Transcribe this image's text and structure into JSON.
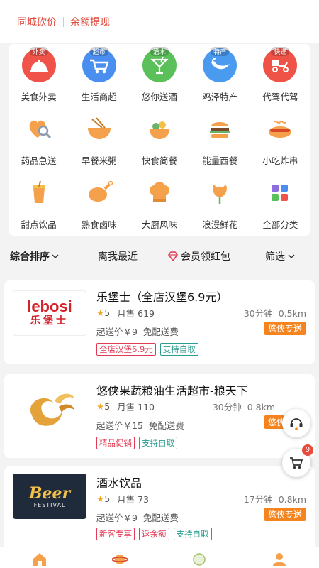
{
  "top": {
    "link1": "同城砍价",
    "link2": "余额提现"
  },
  "categories": [
    {
      "label": "美食外卖",
      "badge": "外卖",
      "icon": "food-cloche-icon",
      "color": "#f0534a"
    },
    {
      "label": "生活商超",
      "badge": "超市",
      "icon": "shopping-cart-icon",
      "color": "#4a8ff0"
    },
    {
      "label": "悠你送酒",
      "badge": "酒水",
      "icon": "cocktail-glass-icon",
      "color": "#5bc05a"
    },
    {
      "label": "鸡泽特产",
      "badge": "特产",
      "icon": "chili-pepper-icon",
      "color": "#4a9aef"
    },
    {
      "label": "代驾代驾",
      "badge": "快递",
      "icon": "delivery-scooter-icon",
      "color": "#ef5246"
    },
    {
      "label": "药品急送",
      "icon": "heart-magnifier-icon"
    },
    {
      "label": "早餐米粥",
      "icon": "noodle-bowl-icon"
    },
    {
      "label": "快食简餐",
      "icon": "rice-bowl-icon"
    },
    {
      "label": "能量西餐",
      "icon": "burger-icon"
    },
    {
      "label": "小吃炸串",
      "icon": "hotdog-icon"
    },
    {
      "label": "甜点饮品",
      "icon": "drink-cup-icon"
    },
    {
      "label": "熟食卤味",
      "icon": "roast-chicken-icon"
    },
    {
      "label": "大厨风味",
      "icon": "chef-hat-icon"
    },
    {
      "label": "浪漫鲜花",
      "icon": "flower-icon"
    },
    {
      "label": "全部分类",
      "icon": "all-categories-icon"
    }
  ],
  "sort": {
    "comprehensive": "综合排序",
    "nearest": "离我最近",
    "member": "会员领红包",
    "filter": "筛选"
  },
  "stores": [
    {
      "name": "乐堡士（全店汉堡6.9元）",
      "rating": "5",
      "sales": "月售 619",
      "time": "30分钟",
      "distance": "0.5km",
      "min_order": "起送价￥9",
      "delivery_fee": "免配送费",
      "delivery": "悠侠专送",
      "tags": [
        {
          "text": "全店汉堡6.9元",
          "kind": "red"
        },
        {
          "text": "支持自取",
          "kind": "green"
        }
      ],
      "logo_text": "lebosi",
      "logo_sub": "乐堡士"
    },
    {
      "name": "悠侠果蔬粮油生活超市-粮天下",
      "rating": "5",
      "sales": "月售 110",
      "time": "30分钟",
      "distance": "0.8km",
      "min_order": "起送价￥15",
      "delivery_fee": "免配送费",
      "delivery": "悠侠专送",
      "tags": [
        {
          "text": "精品促销",
          "kind": "red"
        },
        {
          "text": "支持自取",
          "kind": "green"
        }
      ]
    },
    {
      "name": "酒水饮品",
      "rating": "5",
      "sales": "月售 73",
      "time": "17分钟",
      "distance": "0.8km",
      "min_order": "起送价￥9",
      "delivery_fee": "免配送费",
      "delivery": "悠侠专送",
      "tags": [
        {
          "text": "新客专享",
          "kind": "red"
        },
        {
          "text": "返余额",
          "kind": "red"
        },
        {
          "text": "支持自取",
          "kind": "green"
        }
      ],
      "logo_text": "Beer",
      "logo_sub": "FESTIVAL"
    }
  ],
  "cart": {
    "count": "9"
  },
  "colors": {
    "accent": "#e0473b",
    "delivery": "#f5841f",
    "star": "#f5a623"
  }
}
